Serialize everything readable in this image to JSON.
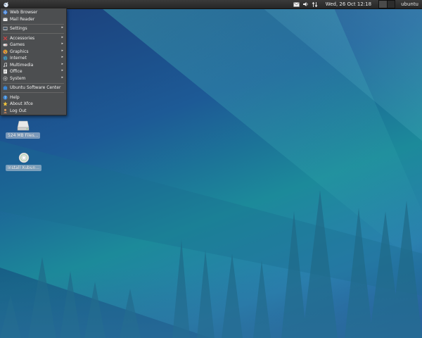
{
  "top_panel": {
    "clock": "Wed, 26 Oct  12:18",
    "username": "ubuntu"
  },
  "menu": {
    "items": [
      {
        "label": "Web Browser",
        "icon": "web-browser-icon"
      },
      {
        "label": "Mail Reader",
        "icon": "mail-reader-icon"
      },
      {
        "label": "Settings",
        "icon": "settings-icon",
        "submenu": true
      },
      {
        "label": "Accessories",
        "icon": "accessories-icon",
        "submenu": true
      },
      {
        "label": "Games",
        "icon": "games-icon",
        "submenu": true
      },
      {
        "label": "Graphics",
        "icon": "graphics-icon",
        "submenu": true
      },
      {
        "label": "Internet",
        "icon": "internet-icon",
        "submenu": true
      },
      {
        "label": "Multimedia",
        "icon": "multimedia-icon",
        "submenu": true
      },
      {
        "label": "Office",
        "icon": "office-icon",
        "submenu": true
      },
      {
        "label": "System",
        "icon": "system-icon",
        "submenu": true
      },
      {
        "label": "Ubuntu Software Center",
        "icon": "software-center-icon"
      },
      {
        "label": "Help",
        "icon": "help-icon"
      },
      {
        "label": "About Xfce",
        "icon": "about-icon"
      },
      {
        "label": "Log Out",
        "icon": "log-out-icon"
      }
    ],
    "submenu_arrow": "▸"
  },
  "desktop_icons": [
    {
      "label": "524 MB Files...",
      "icon": "drive-icon"
    },
    {
      "label": "Install Xubun...",
      "icon": "install-disc-icon"
    }
  ],
  "colors": {
    "panel_bg": "#2e2e2e",
    "menu_bg": "#4e4e4e",
    "wallpaper_base": "#1d5a96",
    "wallpaper_accent": "#1c8a9a"
  }
}
